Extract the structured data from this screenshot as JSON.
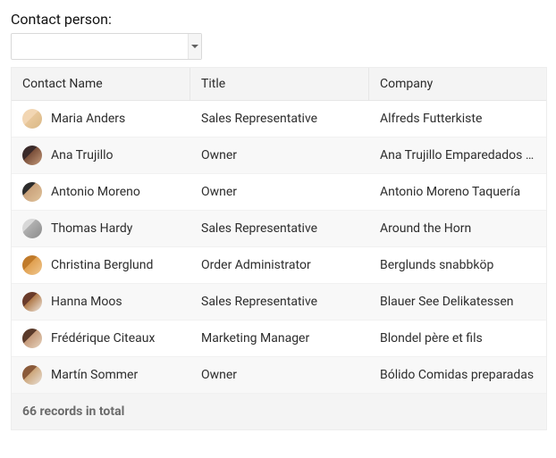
{
  "field": {
    "label": "Contact person:",
    "value": "",
    "placeholder": ""
  },
  "grid": {
    "columns": {
      "name": "Contact Name",
      "title": "Title",
      "company": "Company"
    },
    "rows": [
      {
        "name": "Maria Anders",
        "title": "Sales Representative",
        "company": "Alfreds Futterkiste",
        "avatar": "av1"
      },
      {
        "name": "Ana Trujillo",
        "title": "Owner",
        "company": "Ana Trujillo Emparedados y helados",
        "avatar": "av2"
      },
      {
        "name": "Antonio Moreno",
        "title": "Owner",
        "company": "Antonio Moreno Taquería",
        "avatar": "av3"
      },
      {
        "name": "Thomas Hardy",
        "title": "Sales Representative",
        "company": "Around the Horn",
        "avatar": "av4"
      },
      {
        "name": "Christina Berglund",
        "title": "Order Administrator",
        "company": "Berglunds snabbköp",
        "avatar": "av5"
      },
      {
        "name": "Hanna Moos",
        "title": "Sales Representative",
        "company": "Blauer See Delikatessen",
        "avatar": "av6"
      },
      {
        "name": "Frédérique Citeaux",
        "title": "Marketing Manager",
        "company": "Blondel père et fils",
        "avatar": "av7"
      },
      {
        "name": "Martín Sommer",
        "title": "Owner",
        "company": "Bólido Comidas preparadas",
        "avatar": "av8"
      }
    ],
    "footer": "66 records in total"
  }
}
